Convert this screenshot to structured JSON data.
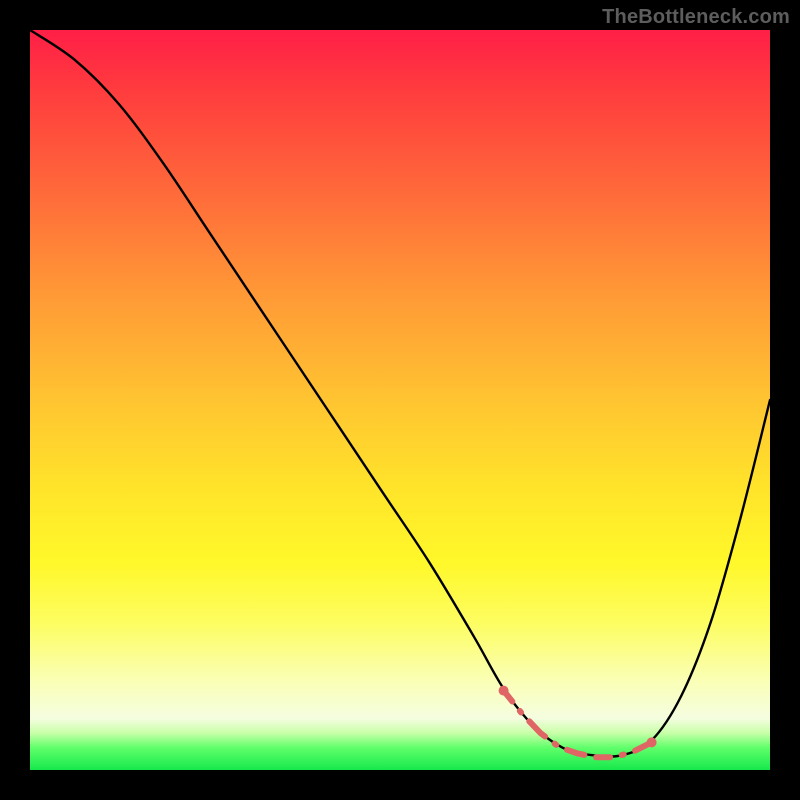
{
  "watermark": "TheBottleneck.com",
  "chart_data": {
    "type": "line",
    "title": "",
    "xlabel": "",
    "ylabel": "",
    "xlim": [
      0,
      100
    ],
    "ylim": [
      0,
      100
    ],
    "grid": false,
    "legend": false,
    "series": [
      {
        "name": "bottleneck-curve",
        "x": [
          0,
          6,
          12,
          18,
          24,
          30,
          36,
          42,
          48,
          54,
          60,
          64,
          68,
          72,
          76,
          80,
          84,
          88,
          92,
          96,
          100
        ],
        "y": [
          100,
          96,
          90,
          82,
          73,
          64,
          55,
          46,
          37,
          28,
          18,
          11,
          6,
          3,
          2,
          2,
          4,
          10,
          20,
          34,
          50
        ]
      }
    ],
    "annotation": {
      "name": "optimal-range",
      "x_start": 64,
      "x_end": 84,
      "style": "dashed-red"
    },
    "background_gradient": {
      "top": "#ff1f47",
      "mid": "#ffe42a",
      "bottom": "#16e84c"
    }
  }
}
